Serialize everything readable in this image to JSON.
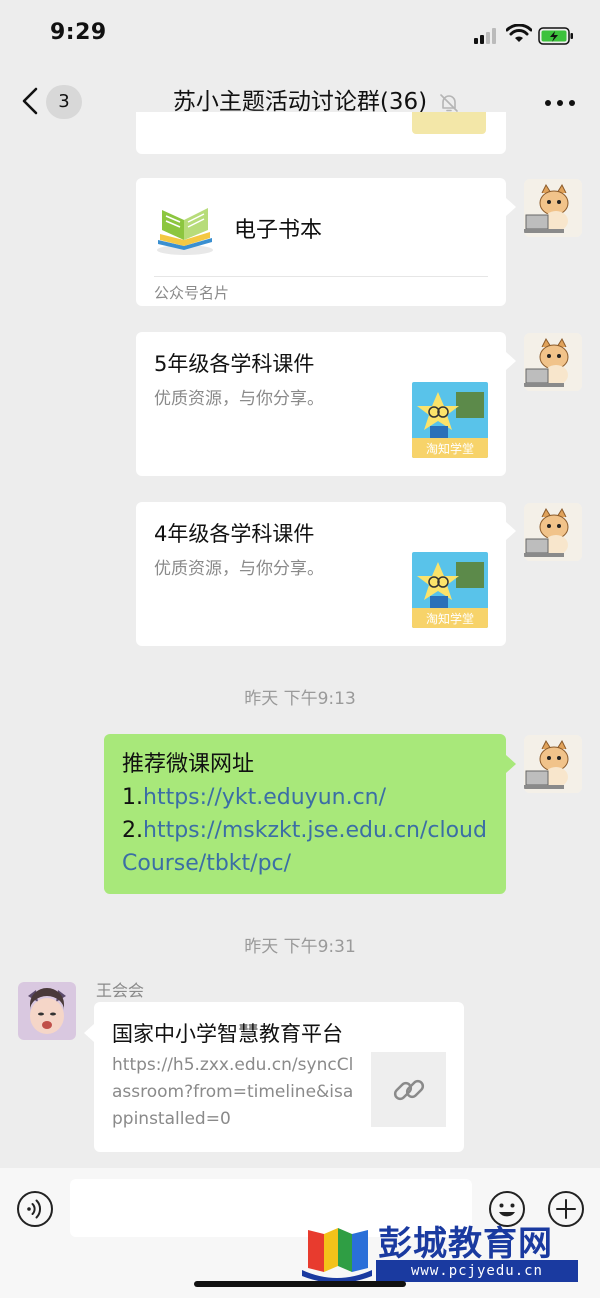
{
  "status_bar": {
    "time": "9:29"
  },
  "header": {
    "unread_count": "3",
    "title": "苏小主题活动讨论群(36)"
  },
  "messages": {
    "ebook_card": {
      "title": "电子书本",
      "footer": "公众号名片"
    },
    "course_cards": [
      {
        "title": "5年级各学科课件",
        "desc": "优质资源，与你分享。",
        "thumb_label": "淘知学堂"
      },
      {
        "title": "4年级各学科课件",
        "desc": "优质资源，与你分享。",
        "thumb_label": "淘知学堂"
      }
    ],
    "timestamp_1": "昨天 下午9:13",
    "text_bubble": {
      "line1": "推荐微课网址",
      "item1_prefix": "1.",
      "item1_link": "https://ykt.eduyun.cn/",
      "item2_prefix": "2.",
      "item2_link_a": "https://mskzkt.jse.edu.cn/cloud",
      "item2_link_b": "Course/tbkt/pc/"
    },
    "timestamp_2": "昨天 下午9:31",
    "sender_name": "王会会",
    "link_card": {
      "title": "国家中小学智慧教育平台",
      "url": "https://h5.zxx.edu.cn/syncClassroom?from=timeline&isappinstalled=0"
    }
  },
  "input_bar": {
    "placeholder": ""
  },
  "watermark": {
    "brand": "彭城教育网",
    "url": "www.pcjyedu.cn"
  },
  "colors": {
    "bubble_green": "#a8e87a",
    "link_blue": "#3b6ea5",
    "background": "#ededed",
    "battery_green": "#3cc23c"
  }
}
